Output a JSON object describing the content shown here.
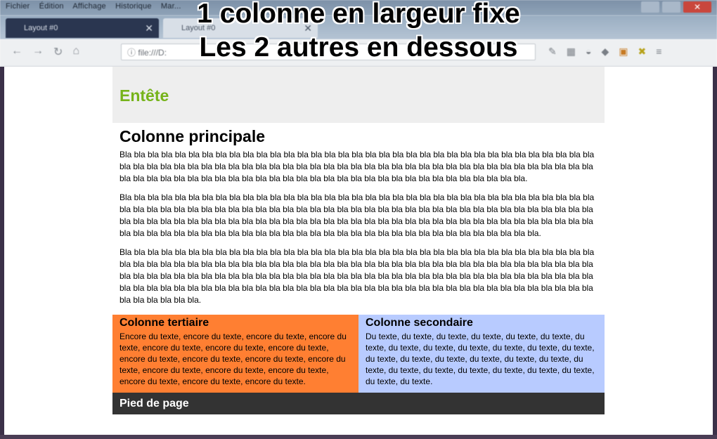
{
  "caption": {
    "line1": "1 colonne en largeur fixe",
    "line2": "Les 2 autres en dessous"
  },
  "browser": {
    "menu": [
      "Fichier",
      "Édition",
      "Affichage",
      "Historique",
      "Mar..."
    ],
    "tabs": [
      {
        "label": "Layout #0",
        "active": true
      },
      {
        "label": "Layout #0",
        "active": false
      }
    ],
    "url": "file:///D:"
  },
  "page": {
    "header_title": "Entête",
    "main_title": "Colonne principale",
    "main_paragraphs": [
      "Bla bla bla bla bla bla bla bla bla bla bla bla bla bla bla bla bla bla bla bla bla bla bla bla bla bla bla bla bla bla bla bla bla bla bla bla bla bla bla bla bla bla bla bla bla bla bla bla bla bla bla bla bla bla bla bla bla bla bla bla bla bla bla bla bla bla bla bla bla bla bla bla bla bla bla bla bla bla bla bla bla bla bla bla bla bla bla bla bla bla bla bla bla bla bla bla bla bla bla bla.",
      "Bla bla bla bla bla bla bla bla bla bla bla bla bla bla bla bla bla bla bla bla bla bla bla bla bla bla bla bla bla bla bla bla bla bla bla bla bla bla bla bla bla bla bla bla bla bla bla bla bla bla bla bla bla bla bla bla bla bla bla bla bla bla bla bla bla bla bla bla bla bla bla bla bla bla bla bla bla bla bla bla bla bla bla bla bla bla bla bla bla bla bla bla bla bla bla bla bla bla bla bla bla bla bla bla bla bla bla bla bla bla bla bla bla bla bla bla bla bla bla bla bla bla bla bla bla bla bla bla bla bla bla bla bla bla bla bla.",
      "Bla bla bla bla bla bla bla bla bla bla bla bla bla bla bla bla bla bla bla bla bla bla bla bla bla bla bla bla bla bla bla bla bla bla bla bla bla bla bla bla bla bla bla bla bla bla bla bla bla bla bla bla bla bla bla bla bla bla bla bla bla bla bla bla bla bla bla bla bla bla bla bla bla bla bla bla bla bla bla bla bla bla bla bla bla bla bla bla bla bla bla bla bla bla bla bla bla bla bla bla bla bla bla bla bla bla bla bla bla bla bla bla bla bla bla bla bla bla bla bla bla bla bla bla bla bla bla bla bla bla bla bla bla bla bla bla bla bla bla bla bla bla bla bla bla bla."
    ],
    "tertiary": {
      "title": "Colonne tertiaire",
      "text": "Encore du texte, encore du texte, encore du texte, encore du texte, encore du texte, encore du texte, encore du texte, encore du texte, encore du texte, encore du texte, encore du texte, encore du texte, encore du texte, encore du texte, encore du texte, encore du texte, encore du texte."
    },
    "secondary": {
      "title": "Colonne secondaire",
      "text": "Du texte, du texte, du texte, du texte, du texte, du texte, du texte, du texte, du texte, du texte, du texte, du texte, du texte, du texte, du texte, du texte, du texte, du texte, du texte, du texte, du texte, du texte, du texte, du texte, du texte, du texte, du texte, du texte."
    },
    "footer": "Pied de page"
  },
  "colors": {
    "header_bg": "#eeeeee",
    "header_title": "#76b31a",
    "tertiary_bg": "#ff7f32",
    "secondary_bg": "#b8cbff",
    "footer_bg": "#333333"
  }
}
